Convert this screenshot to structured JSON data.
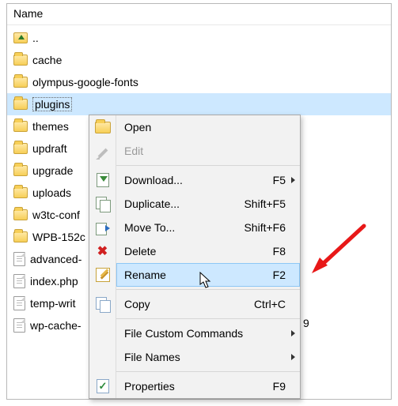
{
  "header": {
    "name_col": "Name"
  },
  "list": {
    "up": "..",
    "items": [
      {
        "type": "folder",
        "label": "cache"
      },
      {
        "type": "folder",
        "label": "olympus-google-fonts"
      },
      {
        "type": "folder",
        "label": "plugins",
        "selected": true
      },
      {
        "type": "folder",
        "label": "themes"
      },
      {
        "type": "folder",
        "label": "updraft"
      },
      {
        "type": "folder",
        "label": "upgrade"
      },
      {
        "type": "folder",
        "label": "uploads"
      },
      {
        "type": "folder",
        "label": "w3tc-conf"
      },
      {
        "type": "folder",
        "label": "WPB-152c"
      },
      {
        "type": "file",
        "label": "advanced-"
      },
      {
        "type": "file",
        "label": "index.php"
      },
      {
        "type": "file",
        "label": "temp-writ"
      },
      {
        "type": "file",
        "label": "wp-cache-"
      }
    ],
    "truncated_suffix": "9"
  },
  "menu": {
    "open": {
      "label": "Open",
      "hotkey": ""
    },
    "edit": {
      "label": "Edit",
      "hotkey": ""
    },
    "download": {
      "label": "Download...",
      "hotkey": "F5"
    },
    "duplicate": {
      "label": "Duplicate...",
      "hotkey": "Shift+F5"
    },
    "moveto": {
      "label": "Move To...",
      "hotkey": "Shift+F6"
    },
    "delete": {
      "label": "Delete",
      "hotkey": "F8"
    },
    "rename": {
      "label": "Rename",
      "hotkey": "F2"
    },
    "copy": {
      "label": "Copy",
      "hotkey": "Ctrl+C"
    },
    "filecustom": {
      "label": "File Custom Commands",
      "hotkey": ""
    },
    "filenames": {
      "label": "File Names",
      "hotkey": ""
    },
    "properties": {
      "label": "Properties",
      "hotkey": "F9"
    }
  }
}
